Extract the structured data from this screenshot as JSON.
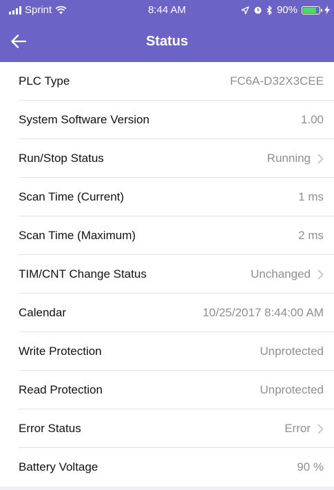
{
  "status_bar": {
    "carrier": "Sprint",
    "time": "8:44 AM",
    "battery": "90%",
    "battery_level": 0.9
  },
  "nav": {
    "title": "Status"
  },
  "rows": [
    {
      "label": "PLC Type",
      "value": "FC6A-D32X3CEE"
    },
    {
      "label": "System Software Version",
      "value": "1.00"
    },
    {
      "label": "Run/Stop Status",
      "value": "Running"
    },
    {
      "label": "Scan Time (Current)",
      "value": "1 ms"
    },
    {
      "label": "Scan Time (Maximum)",
      "value": "2 ms"
    },
    {
      "label": "TIM/CNT Change Status",
      "value": "Unchanged"
    },
    {
      "label": "Calendar",
      "value": "10/25/2017 8:44:00 AM"
    },
    {
      "label": "Write Protection",
      "value": "Unprotected"
    },
    {
      "label": "Read Protection",
      "value": "Unprotected"
    },
    {
      "label": "Error Status",
      "value": "Error"
    },
    {
      "label": "Battery Voltage",
      "value": "90 %"
    }
  ]
}
